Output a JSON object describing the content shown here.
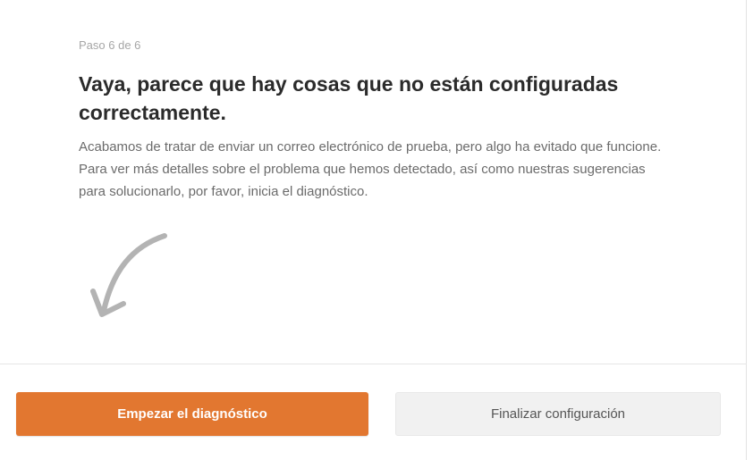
{
  "wizard": {
    "step_label": "Paso 6 de 6",
    "title": "Vaya, parece que hay cosas que no están configuradas correctamente.",
    "description": "Acabamos de tratar de enviar un correo electrónico de prueba, pero algo ha evitado que funcione. Para ver más detalles sobre el problema que hemos detectado, así como nuestras sugerencias para solucionarlo, por favor, inicia el diagnóstico.",
    "arrow_icon": "curved-arrow-down-left-icon"
  },
  "footer": {
    "primary_button_label": "Empezar el diagnóstico",
    "secondary_button_label": "Finalizar configuración"
  },
  "colors": {
    "primary_accent": "#e27730",
    "secondary_button_bg": "#f1f1f1",
    "arrow_gray": "#b3b3b3"
  }
}
